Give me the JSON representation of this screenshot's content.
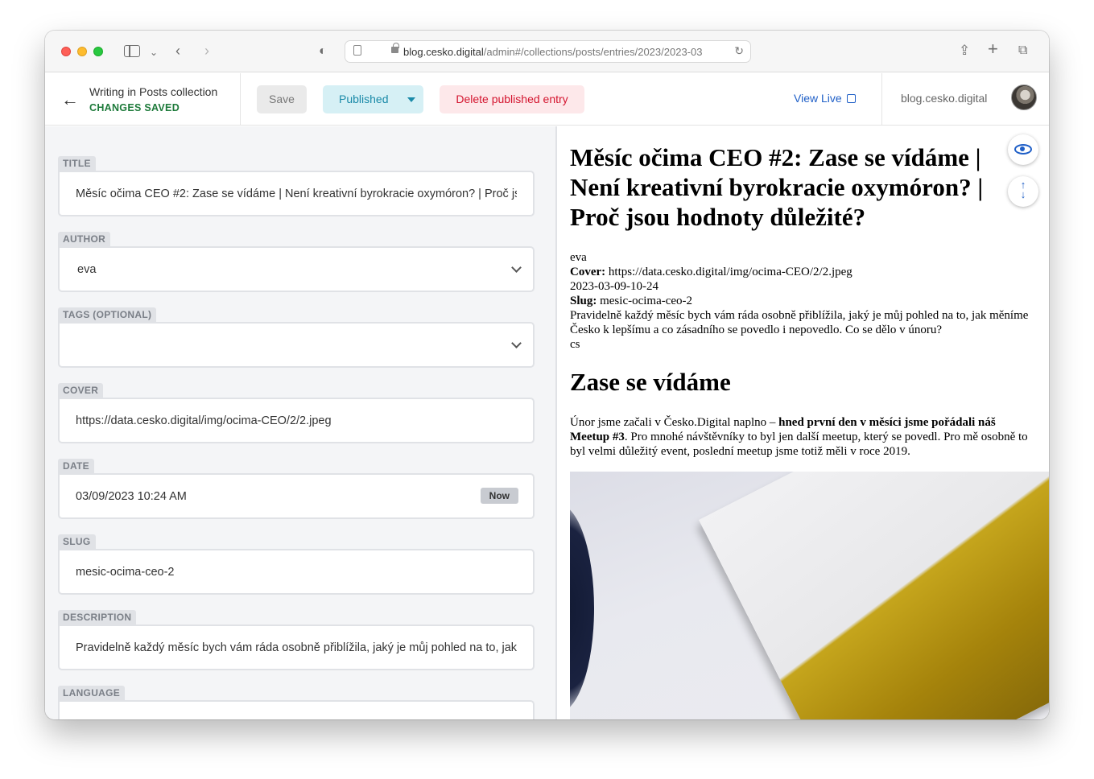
{
  "browser": {
    "url_host": "blog.cesko.digital",
    "url_path": "/admin#/collections/posts/entries/2023/2023-03"
  },
  "header": {
    "collection_title": "Writing in Posts collection",
    "status": "CHANGES SAVED",
    "save_label": "Save",
    "published_label": "Published",
    "delete_label": "Delete published entry",
    "view_live_label": "View Live",
    "site_name": "blog.cesko.digital"
  },
  "fields": {
    "title": {
      "label": "TITLE",
      "value": "Měsíc očima CEO #2: Zase se vídáme | Není kreativní byrokracie oxymóron? | Proč jsou hodnoty důležité?"
    },
    "author": {
      "label": "AUTHOR",
      "value": "eva"
    },
    "tags": {
      "label": "TAGS (OPTIONAL)",
      "value": ""
    },
    "cover": {
      "label": "COVER",
      "value": "https://data.cesko.digital/img/ocima-CEO/2/2.jpeg"
    },
    "date": {
      "label": "DATE",
      "value": "03/09/2023 10:24 AM",
      "now_label": "Now"
    },
    "slug": {
      "label": "SLUG",
      "value": "mesic-ocima-ceo-2"
    },
    "description": {
      "label": "DESCRIPTION",
      "value": "Pravidelně každý měsíc bych vám ráda osobně přiblížila, jaký je můj pohled na to, jak měníme Česko k lepšímu a co zásadního se povedlo i nepovedlo. Co se dělo v únoru?"
    },
    "language": {
      "label": "LANGUAGE",
      "value": ""
    }
  },
  "preview": {
    "title": "Měsíc očima CEO #2: Zase se vídáme | Není kreativní byrokracie oxymóron? | Proč jsou hodnoty důležité?",
    "author": "eva",
    "cover_label": "Cover:",
    "cover_value": "https://data.cesko.digital/img/ocima-CEO/2/2.jpeg",
    "date": "2023-03-09-10-24",
    "slug_label": "Slug:",
    "slug_value": "mesic-ocima-ceo-2",
    "description": "Pravidelně každý měsíc bych vám ráda osobně přiblížila, jaký je můj pohled na to, jak měníme Česko k lepšímu a co zásadního se povedlo i nepovedlo. Co se dělo v únoru?",
    "language": "cs",
    "heading": "Zase se vídáme",
    "para_start": "Únor jsme začali v Česko.Digital naplno – ",
    "para_bold": "hned první den v měsíci jsme pořádali náš Meetup #3",
    "para_end": ". Pro mnohé návštěvníky to byl jen další meetup, který se povedl. Pro mě osobně to byl velmi důležitý event, poslední meetup jsme totiž měli v roce 2019."
  }
}
